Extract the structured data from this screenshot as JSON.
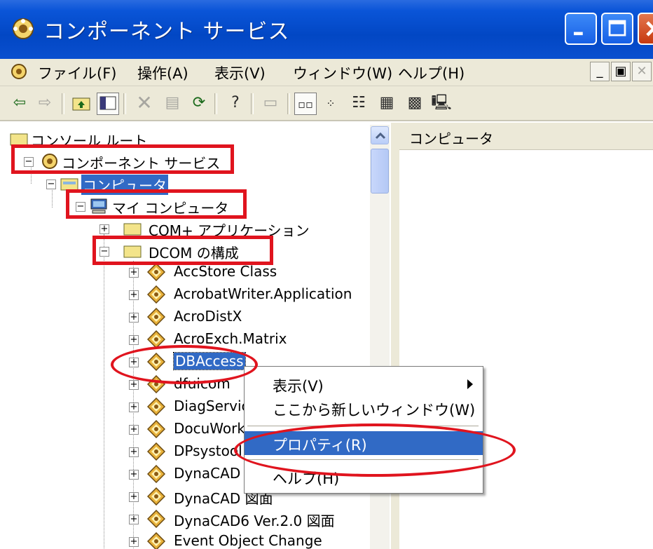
{
  "window": {
    "title": "コンポーネント サービス",
    "title_icon": "component-services-icon"
  },
  "menubar": {
    "items": [
      "ファイル(F)",
      "操作(A)",
      "表示(V)",
      "ウィンドウ(W)",
      "ヘルプ(H)"
    ]
  },
  "toolbar": {
    "buttons": [
      "back",
      "forward",
      "up-one-level",
      "show-hide-console-tree",
      "delete",
      "properties",
      "refresh",
      "help",
      "new-window",
      "large-icons",
      "small-icons",
      "list",
      "detail",
      "detail-alt",
      "computer"
    ]
  },
  "tree": {
    "root": "コンソール ルート",
    "component_services": "コンポーネント サービス",
    "computers": "コンピュータ",
    "my_computer": "マイ コンピュータ",
    "com_plus": "COM+ アプリケーション",
    "dcom_config": "DCOM の構成",
    "items": [
      "AccStore Class",
      "AcrobatWriter.Application",
      "AcroDistX",
      "AcroExch.Matrix",
      "DBAccess",
      "dfuicom",
      "DiagServic",
      "DocuWork",
      "DPsystool",
      "DynaCAD",
      "DynaCAD 図面",
      "DynaCAD6 Ver.2.0 図面",
      "Event Object Change"
    ]
  },
  "right_pane": {
    "header": "コンピュータ"
  },
  "context_menu": {
    "items": [
      "表示(V)",
      "ここから新しいウィンドウ(W)",
      "プロパティ(R)",
      "ヘルプ(H)"
    ],
    "highlighted": "プロパティ(R)"
  },
  "annotations": {
    "color": "#e0141e"
  },
  "colors": {
    "title_bar": "#0a55d8",
    "selection": "#316ac5",
    "chrome": "#ece9d8"
  }
}
